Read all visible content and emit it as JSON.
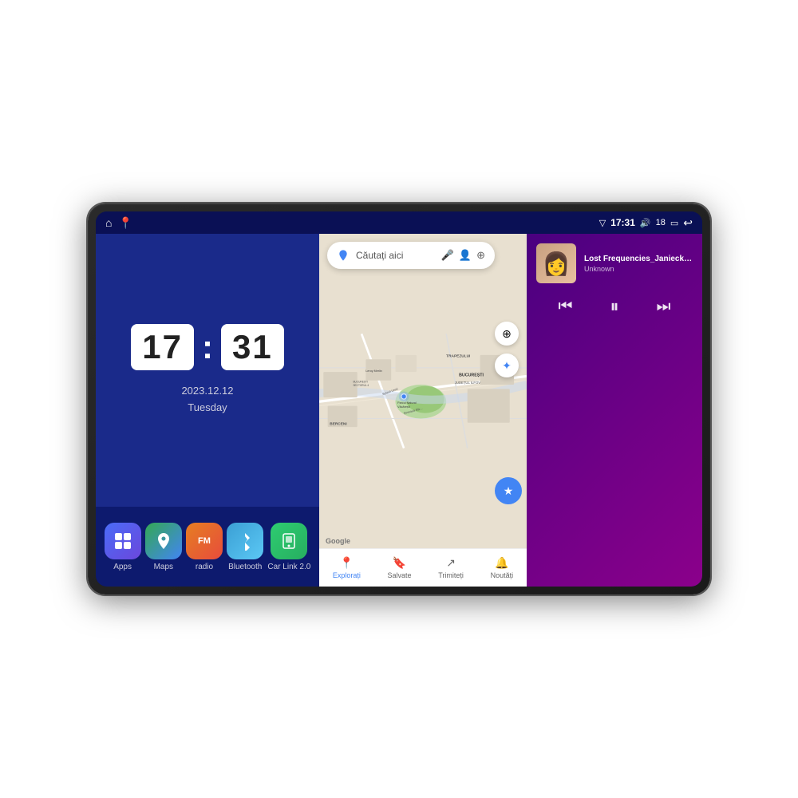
{
  "device": {
    "screen": {
      "status_bar": {
        "left_icons": [
          "home",
          "maps"
        ],
        "signal_icon": "▽",
        "time": "17:31",
        "volume_icon": "🔊",
        "volume_level": "18",
        "battery_icon": "🔋",
        "back_icon": "↩"
      }
    }
  },
  "clock": {
    "hours": "17",
    "minutes": "31",
    "date": "2023.12.12",
    "day": "Tuesday"
  },
  "apps": [
    {
      "id": "apps",
      "label": "Apps",
      "icon": "⊞",
      "color_class": "icon-apps"
    },
    {
      "id": "maps",
      "label": "Maps",
      "icon": "📍",
      "color_class": "icon-maps"
    },
    {
      "id": "radio",
      "label": "radio",
      "icon": "📻",
      "color_class": "icon-radio"
    },
    {
      "id": "bluetooth",
      "label": "Bluetooth",
      "icon": "₿",
      "color_class": "icon-bluetooth"
    },
    {
      "id": "carlink",
      "label": "Car Link 2.0",
      "icon": "📱",
      "color_class": "icon-carlink"
    }
  ],
  "map": {
    "search_placeholder": "Căutați aici",
    "nav_items": [
      {
        "id": "explore",
        "label": "Explorați",
        "icon": "📍",
        "active": true
      },
      {
        "id": "saved",
        "label": "Salvate",
        "icon": "🔖",
        "active": false
      },
      {
        "id": "share",
        "label": "Trimiteți",
        "icon": "↗",
        "active": false
      },
      {
        "id": "news",
        "label": "Noutăți",
        "icon": "🔔",
        "active": false
      }
    ],
    "labels": [
      "TRAPEZULUI",
      "BUCUREȘTI",
      "JUDEȚUL ILFOV",
      "BERCENI",
      "Parcul Natural Văcărești",
      "Leroy Merlin",
      "BUCUREȘTI SECTORUL 4",
      "Splaiul Unirii",
      "Șoseaua Bâr..."
    ]
  },
  "music": {
    "title": "Lost Frequencies_Janieck Devy-...",
    "artist": "Unknown",
    "controls": {
      "prev": "⏮",
      "play": "⏸",
      "next": "⏭"
    }
  }
}
